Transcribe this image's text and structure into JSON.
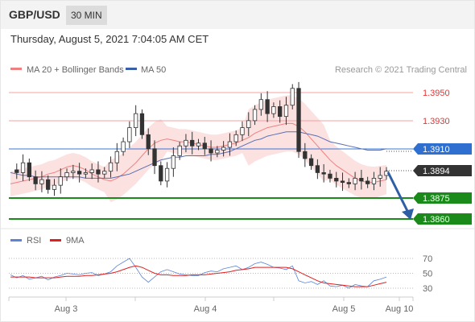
{
  "header": {
    "symbol": "GBP/USD",
    "timeframe": "30 MIN"
  },
  "timestamp": "Thursday, August 5, 2021 7:04:05 AM CET",
  "legend": {
    "items": [
      {
        "label": "MA 20 + Bollinger Bands",
        "color": "#f08080"
      },
      {
        "label": "MA 50",
        "color": "#3a5ea8"
      }
    ],
    "copyright": "Research © 2021 Trading Central"
  },
  "levels": [
    {
      "value": "1.3950",
      "kind": "resistance",
      "color": "#e05050"
    },
    {
      "value": "1.3930",
      "kind": "resistance",
      "color": "#e05050"
    },
    {
      "value": "1.3910",
      "kind": "ma50",
      "color": "#2f6fd0"
    },
    {
      "value": "1.3894",
      "kind": "last",
      "color": "#333333"
    },
    {
      "value": "1.3875",
      "kind": "support",
      "color": "#1a8a1a"
    },
    {
      "value": "1.3860",
      "kind": "support",
      "color": "#1a8a1a"
    }
  ],
  "rsi_legend": [
    {
      "label": "RSI",
      "color": "#5b84d6"
    },
    {
      "label": "9MA",
      "color": "#e02020"
    }
  ],
  "chart_data": [
    {
      "type": "candlestick",
      "title": "GBP/USD",
      "ylim": [
        1.3855,
        1.3962
      ],
      "x_ticks": [
        "Aug 3",
        "Aug 4",
        "Aug 5",
        "Aug 10"
      ],
      "series": [
        {
          "name": "MA 20 + Bollinger Bands",
          "values": [
            1.3885,
            1.3886,
            1.3887,
            1.3888,
            1.3889,
            1.389,
            1.3892,
            1.3893,
            1.3895,
            1.3897,
            1.3898,
            1.3897,
            1.3895,
            1.3892,
            1.389,
            1.3888,
            1.3887,
            1.3889,
            1.3892,
            1.3896,
            1.39,
            1.3905,
            1.391,
            1.3914,
            1.3916,
            1.3917,
            1.3916,
            1.3915,
            1.3915,
            1.3914,
            1.3913,
            1.3912,
            1.3911,
            1.3911,
            1.3912,
            1.3913,
            1.3914,
            1.3916,
            1.3918,
            1.3921,
            1.3923,
            1.3925,
            1.3926,
            1.3927,
            1.3928,
            1.3928,
            1.3926,
            1.3922,
            1.3917,
            1.3912,
            1.3907,
            1.3902,
            1.3898,
            1.3895,
            1.3892,
            1.3889,
            1.3887,
            1.3886,
            1.3886,
            1.3887,
            1.3888
          ]
        },
        {
          "name": "MA 50",
          "values": [
            1.3893,
            1.3892,
            1.3891,
            1.3891,
            1.389,
            1.389,
            1.389,
            1.389,
            1.389,
            1.389,
            1.389,
            1.389,
            1.3889,
            1.3889,
            1.3889,
            1.3889,
            1.3889,
            1.389,
            1.3891,
            1.3892,
            1.3894,
            1.3896,
            1.3898,
            1.39,
            1.3902,
            1.3903,
            1.3904,
            1.3904,
            1.3905,
            1.3905,
            1.3905,
            1.3905,
            1.3906,
            1.3906,
            1.3907,
            1.3908,
            1.391,
            1.3912,
            1.3914,
            1.3916,
            1.3917,
            1.3919,
            1.392,
            1.3921,
            1.3922,
            1.3922,
            1.3922,
            1.3921,
            1.392,
            1.3919,
            1.3917,
            1.3915,
            1.3914,
            1.3913,
            1.3912,
            1.3911,
            1.391,
            1.3909,
            1.3909,
            1.3909,
            1.391
          ]
        },
        {
          "name": "Price",
          "values": [
            1.3895,
            1.3893,
            1.39,
            1.389,
            1.3885,
            1.3888,
            1.3881,
            1.3884,
            1.389,
            1.3893,
            1.3894,
            1.3892,
            1.3893,
            1.3895,
            1.3892,
            1.3894,
            1.39,
            1.3908,
            1.3915,
            1.3925,
            1.3935,
            1.392,
            1.391,
            1.3898,
            1.3887,
            1.3896,
            1.3905,
            1.3912,
            1.3916,
            1.3912,
            1.3914,
            1.391,
            1.3907,
            1.3909,
            1.3911,
            1.3915,
            1.392,
            1.3925,
            1.393,
            1.3938,
            1.3945,
            1.3935,
            1.394,
            1.3933,
            1.3941,
            1.3953,
            1.3908,
            1.3903,
            1.3898,
            1.3893,
            1.3892,
            1.3889,
            1.3887,
            1.3886,
            1.3885,
            1.3889,
            1.3887,
            1.3885,
            1.3889,
            1.3891,
            1.3894
          ]
        }
      ]
    },
    {
      "type": "line",
      "title": "RSI",
      "ylim": [
        20,
        80
      ],
      "y_ticks": [
        30,
        50,
        70
      ],
      "series": [
        {
          "name": "RSI",
          "values": [
            48,
            44,
            47,
            42,
            44,
            46,
            41,
            45,
            47,
            50,
            49,
            48,
            50,
            51,
            47,
            49,
            52,
            60,
            65,
            70,
            58,
            45,
            38,
            45,
            52,
            55,
            52,
            49,
            48,
            47,
            47,
            51,
            53,
            52,
            56,
            58,
            60,
            55,
            58,
            63,
            65,
            62,
            58,
            57,
            55,
            60,
            40,
            37,
            39,
            35,
            40,
            33,
            32,
            34,
            30,
            35,
            33,
            32,
            40,
            42,
            45
          ]
        },
        {
          "name": "9MA",
          "values": [
            45,
            45,
            45,
            45,
            44,
            44,
            44,
            44,
            45,
            46,
            46,
            46,
            47,
            47,
            48,
            49,
            50,
            52,
            55,
            58,
            60,
            58,
            54,
            50,
            48,
            48,
            47,
            47,
            47,
            48,
            48,
            48,
            49,
            50,
            51,
            52,
            54,
            55,
            56,
            58,
            58,
            58,
            58,
            58,
            58,
            56,
            52,
            48,
            44,
            40,
            37,
            36,
            35,
            34,
            33,
            32,
            32,
            32,
            34,
            36,
            38
          ]
        }
      ]
    }
  ]
}
